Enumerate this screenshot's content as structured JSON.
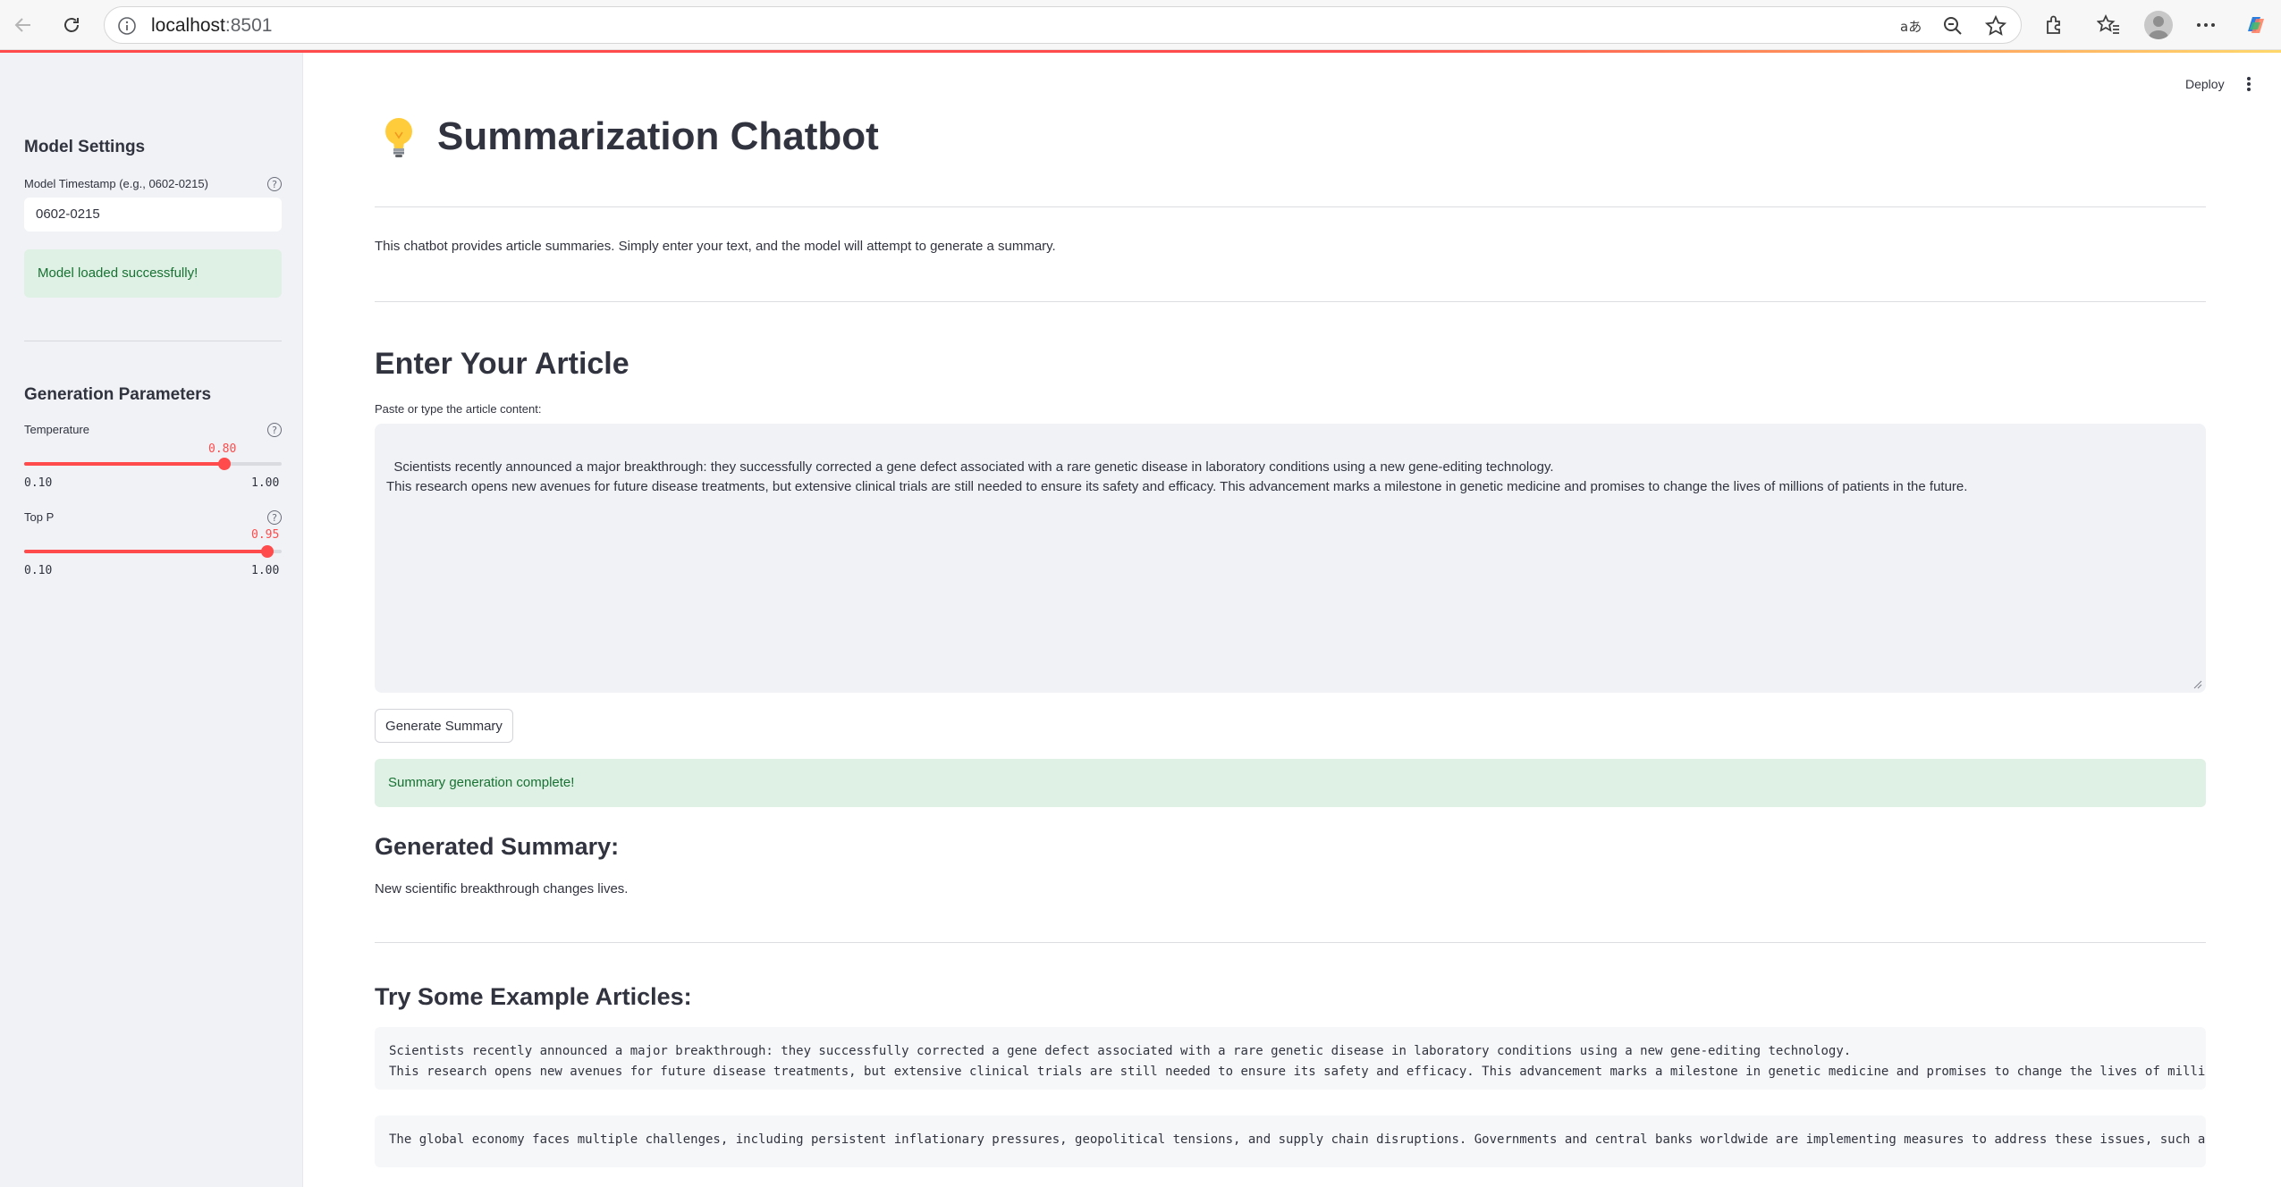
{
  "browser": {
    "url_host": "localhost",
    "url_port": ":8501"
  },
  "sidebar": {
    "model_settings_title": "Model Settings",
    "timestamp_label": "Model Timestamp (e.g., 0602-0215)",
    "timestamp_value": "0602-0215",
    "model_loaded_message": "Model loaded successfully!",
    "generation_title": "Generation Parameters",
    "temperature": {
      "label": "Temperature",
      "value": 0.8,
      "value_text": "0.80",
      "min_text": "0.10",
      "max_text": "1.00",
      "min": 0.1,
      "max": 1.0
    },
    "top_p": {
      "label": "Top P",
      "value": 0.95,
      "value_text": "0.95",
      "min_text": "0.10",
      "max_text": "1.00",
      "min": 0.1,
      "max": 1.0
    }
  },
  "header": {
    "deploy_label": "Deploy",
    "title": "Summarization Chatbot",
    "intro": "This chatbot provides article summaries. Simply enter your text, and the model will attempt to generate a summary."
  },
  "article": {
    "heading": "Enter Your Article",
    "input_label": "Paste or type the article content:",
    "input_value": "Scientists recently announced a major breakthrough: they successfully corrected a gene defect associated with a rare genetic disease in laboratory conditions using a new gene-editing technology.\nThis research opens new avenues for future disease treatments, but extensive clinical trials are still needed to ensure its safety and efficacy. This advancement marks a milestone in genetic medicine and promises to change the lives of millions of patients in the future.",
    "generate_button": "Generate Summary",
    "complete_message": "Summary generation complete!"
  },
  "summary": {
    "heading": "Generated Summary:",
    "text": "New scientific breakthrough changes lives."
  },
  "examples": {
    "heading": "Try Some Example Articles:",
    "items": [
      "Scientists recently announced a major breakthrough: they successfully corrected a gene defect associated with a rare genetic disease in laboratory conditions using a new gene-editing technology.\nThis research opens new avenues for future disease treatments, but extensive clinical trials are still needed to ensure its safety and efficacy. This advancement marks a milestone in genetic medicine and promises to change the lives of millic",
      "The global economy faces multiple challenges, including persistent inflationary pressures, geopolitical tensions, and supply chain disruptions. Governments and central banks worldwide are implementing measures to address these issues, such as"
    ]
  },
  "colors": {
    "accent": "#ff4b4b",
    "success_bg": "#dff0e4",
    "success_text": "#177233",
    "sidebar_bg": "#f0f2f6"
  },
  "icons": [
    "back-arrow-icon",
    "reload-icon",
    "info-icon",
    "translate-icon",
    "zoom-out-icon",
    "star-icon",
    "extensions-icon",
    "favorites-icon",
    "profile-icon",
    "more-icon",
    "copilot-icon",
    "help-icon",
    "lightbulb-icon",
    "kebab-menu-icon"
  ]
}
